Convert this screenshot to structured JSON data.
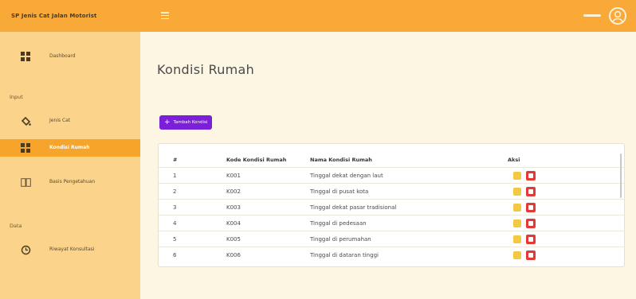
{
  "app": {
    "title": "SP Jenis Cat Jalan Motorist"
  },
  "sidebar": {
    "items": [
      {
        "label": "Dashboard",
        "icon": "dashboard-icon"
      },
      {
        "label": "Jenis Cat",
        "icon": "paint-bucket-icon"
      },
      {
        "label": "Kondisi Rumah",
        "icon": "house-condition-icon",
        "active": true
      },
      {
        "label": "Basis Pengetahuan",
        "icon": "book-icon"
      },
      {
        "label": "Riwayat Konsultasi",
        "icon": "history-icon"
      }
    ],
    "sections": [
      "Input",
      "Data"
    ]
  },
  "main": {
    "title": "Kondisi Rumah",
    "add_button": "Tambah Kondisi",
    "table": {
      "headers": [
        "#",
        "Kode Kondisi Rumah",
        "Nama Kondisi Rumah",
        "Aksi"
      ],
      "rows": [
        {
          "num": "1",
          "code": "K001",
          "name": "Tinggal dekat dengan laut"
        },
        {
          "num": "2",
          "code": "K002",
          "name": "Tinggal di pusat kota"
        },
        {
          "num": "3",
          "code": "K003",
          "name": "Tinggal dekat pasar tradisional"
        },
        {
          "num": "4",
          "code": "K004",
          "name": "Tinggal di pedesaan"
        },
        {
          "num": "5",
          "code": "K005",
          "name": "Tinggal di perumahan"
        },
        {
          "num": "6",
          "code": "K006",
          "name": "Tinggal di dataran tinggi"
        }
      ]
    }
  },
  "colors": {
    "accent": "#f9a937",
    "sidebar_bg": "#fbd38a",
    "primary_button": "#7b1fd8",
    "edit": "#f5c842",
    "delete": "#e53935"
  }
}
